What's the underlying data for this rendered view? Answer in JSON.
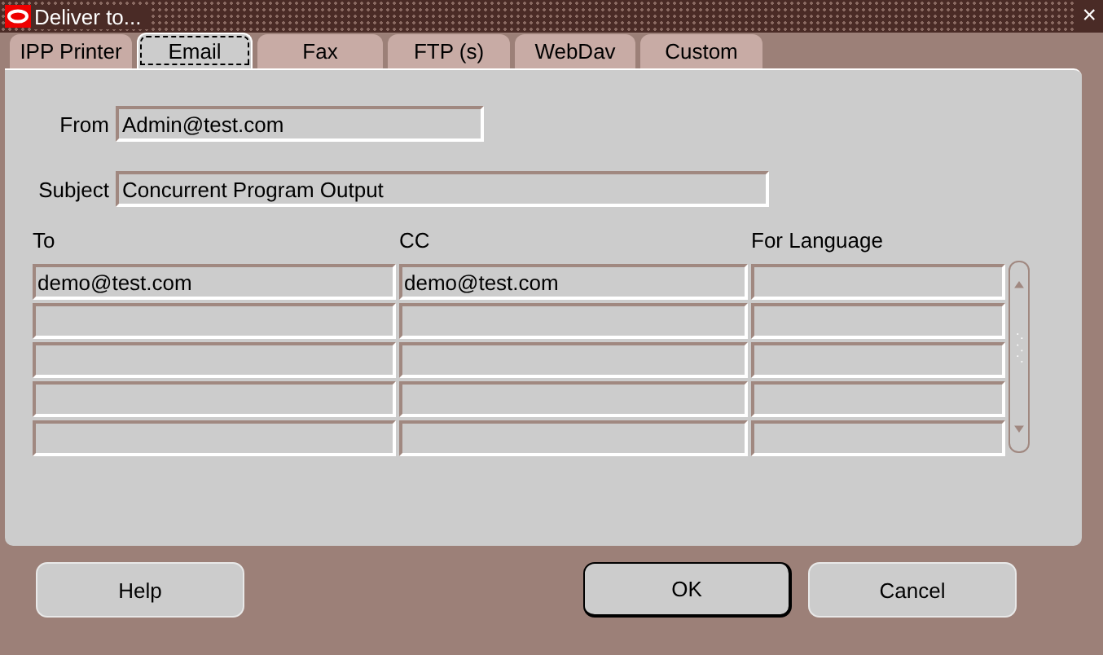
{
  "window": {
    "title": "Deliver to...",
    "close": "×"
  },
  "tabs": [
    {
      "label": "IPP Printer",
      "selected": false
    },
    {
      "label": "Email",
      "selected": true
    },
    {
      "label": "Fax",
      "selected": false
    },
    {
      "label": "FTP (s)",
      "selected": false
    },
    {
      "label": "WebDav",
      "selected": false
    },
    {
      "label": "Custom",
      "selected": false
    }
  ],
  "fields": [
    {
      "label": "From",
      "value": "Admin@test.com",
      "kind": "short"
    },
    {
      "label": "Subject",
      "value": "Concurrent Program Output",
      "kind": "long"
    }
  ],
  "table": {
    "columns": [
      "To",
      "CC",
      "For Language"
    ],
    "rows": [
      [
        "demo@test.com",
        "demo@test.com",
        ""
      ],
      [
        "",
        "",
        ""
      ],
      [
        "",
        "",
        ""
      ],
      [
        "",
        "",
        ""
      ],
      [
        "",
        "",
        ""
      ]
    ]
  },
  "buttons": [
    {
      "label": "Help",
      "default": false
    },
    {
      "label": "OK",
      "default": true
    },
    {
      "label": "Cancel",
      "default": false
    }
  ]
}
